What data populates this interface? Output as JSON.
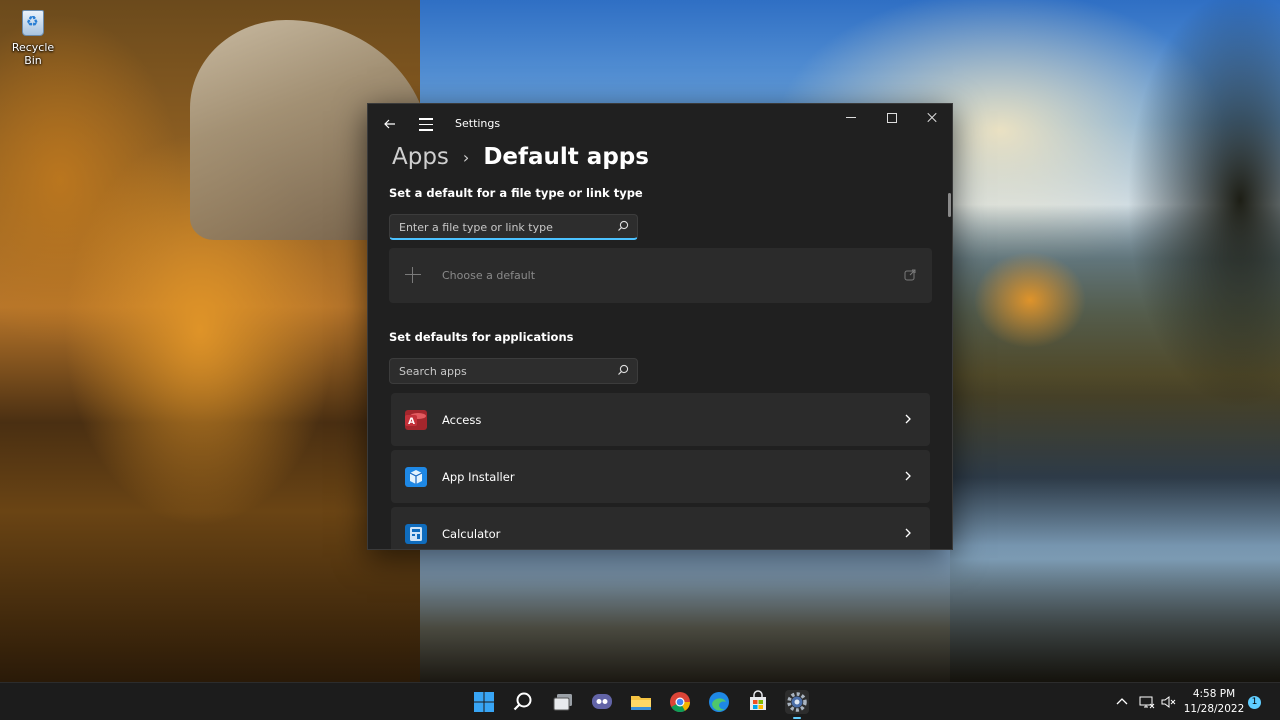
{
  "desktop": {
    "icons": [
      {
        "label": "Recycle Bin",
        "icon": "recycle-bin-icon"
      }
    ]
  },
  "window": {
    "title": "Settings",
    "breadcrumb": {
      "parent": "Apps",
      "separator": "›",
      "current": "Default apps"
    },
    "file_type_section": {
      "title": "Set a default for a file type or link type",
      "search_placeholder": "Enter a file type or link type",
      "search_value": "",
      "choose_label": "Choose a default"
    },
    "apps_section": {
      "title": "Set defaults for applications",
      "search_placeholder": "Search apps",
      "search_value": "",
      "apps": [
        {
          "label": "Access",
          "icon": "access-icon",
          "color": "#a4262c"
        },
        {
          "label": "App Installer",
          "icon": "app-installer-icon",
          "color": "#1e88e5"
        },
        {
          "label": "Calculator",
          "icon": "calculator-icon",
          "color": "#0f6cbd"
        }
      ]
    }
  },
  "taskbar": {
    "icons": [
      "start-icon",
      "search-icon",
      "task-view-icon",
      "chat-icon",
      "file-explorer-icon",
      "chrome-icon",
      "edge-icon",
      "store-icon",
      "settings-icon"
    ],
    "time": "4:58 PM",
    "date": "11/28/2022",
    "notification_count": "1"
  },
  "colors": {
    "accent": "#4cc2ff",
    "window_bg": "#202020",
    "card_bg": "#2b2b2b"
  }
}
